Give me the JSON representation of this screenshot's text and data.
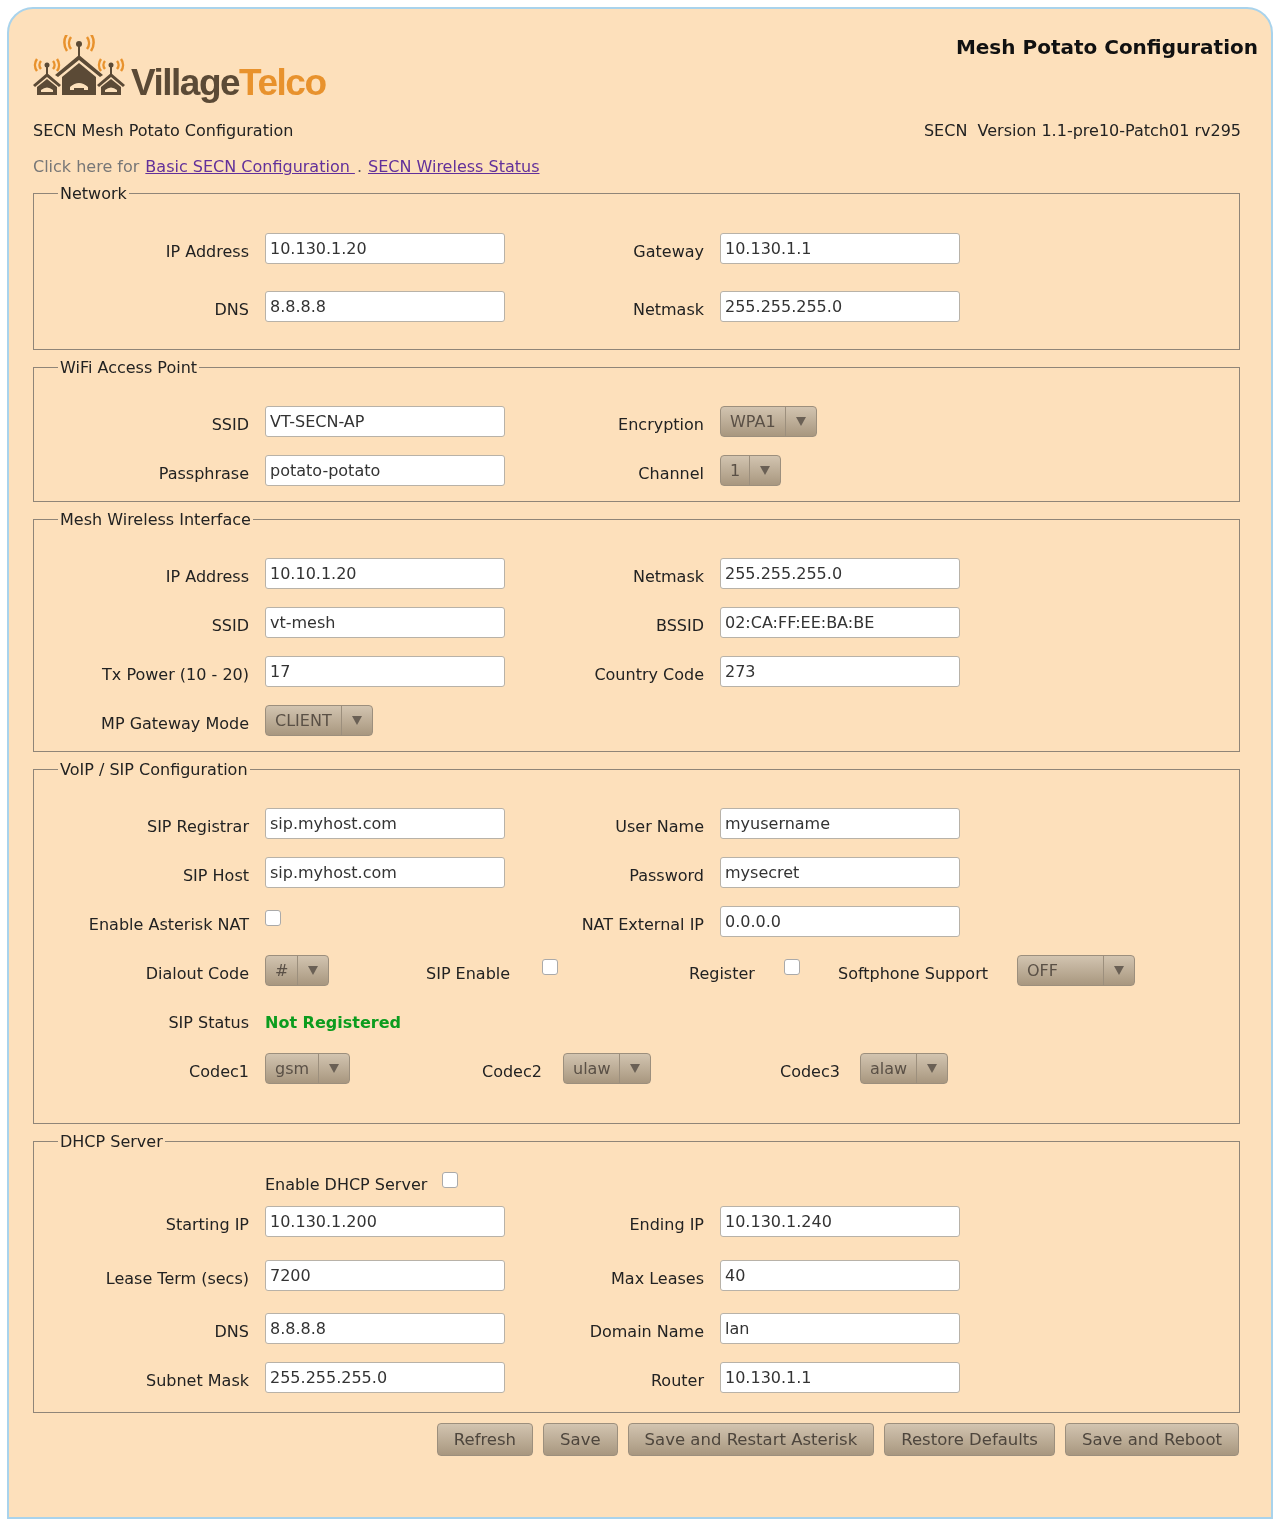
{
  "header": {
    "logo": {
      "wordmark": [
        "Village",
        "Telco"
      ]
    },
    "title": "Mesh Potato Configuration",
    "subtitle": "SECN Mesh Potato Configuration",
    "version": "SECN  Version 1.1-pre10-Patch01 rv295",
    "links_intro": "Click here for",
    "links": [
      "Basic SECN Configuration ",
      "SECN Wireless Status"
    ],
    "link_separator": "."
  },
  "sections": [
    {
      "legend": "Network",
      "rows": [
        {
          "kind": "fields",
          "items": [
            {
              "kind": "text",
              "label": "IP Address",
              "value": "10.130.1.20"
            },
            {
              "kind": "text",
              "label": "Gateway",
              "value": "10.130.1.1"
            }
          ]
        },
        {
          "kind": "fields",
          "items": [
            {
              "kind": "text",
              "label": "DNS",
              "value": "8.8.8.8"
            },
            {
              "kind": "text",
              "label": "Netmask",
              "value": "255.255.255.0"
            }
          ]
        }
      ]
    },
    {
      "legend": "WiFi Access Point",
      "rows": [
        {
          "kind": "fields",
          "items": [
            {
              "kind": "text",
              "label": "SSID",
              "value": "VT-SECN-AP"
            },
            {
              "kind": "select",
              "label": "Encryption",
              "value": "WPA1"
            }
          ]
        },
        {
          "kind": "fields",
          "items": [
            {
              "kind": "text",
              "label": "Passphrase",
              "value": "potato-potato"
            },
            {
              "kind": "select",
              "label": "Channel",
              "value": "1"
            }
          ]
        }
      ]
    },
    {
      "legend": "Mesh Wireless Interface",
      "rows": [
        {
          "kind": "fields",
          "items": [
            {
              "kind": "text",
              "label": "IP Address",
              "value": "10.10.1.20"
            },
            {
              "kind": "text",
              "label": "Netmask",
              "value": "255.255.255.0"
            }
          ]
        },
        {
          "kind": "fields",
          "items": [
            {
              "kind": "text",
              "label": "SSID",
              "value": "vt-mesh"
            },
            {
              "kind": "text",
              "label": "BSSID",
              "value": "02:CA:FF:EE:BA:BE"
            }
          ]
        },
        {
          "kind": "fields",
          "items": [
            {
              "kind": "text",
              "label": "Tx Power (10 - 20)",
              "value": "17"
            },
            {
              "kind": "text",
              "label": "Country Code",
              "value": "273"
            }
          ]
        },
        {
          "kind": "fields",
          "items": [
            {
              "kind": "select",
              "label": "MP Gateway Mode",
              "value": "CLIENT"
            }
          ]
        }
      ]
    },
    {
      "legend": "VoIP / SIP Configuration",
      "rows": [
        {
          "kind": "fields",
          "items": [
            {
              "kind": "text",
              "label": "SIP Registrar",
              "value": "sip.myhost.com"
            },
            {
              "kind": "text",
              "label": "User Name",
              "value": "myusername"
            }
          ]
        },
        {
          "kind": "fields",
          "items": [
            {
              "kind": "text",
              "label": "SIP Host",
              "value": "sip.myhost.com"
            },
            {
              "kind": "text",
              "label": "Password",
              "value": "mysecret"
            }
          ]
        },
        {
          "kind": "fields",
          "items": [
            {
              "kind": "checkbox",
              "label": "Enable Asterisk NAT",
              "checked": false
            },
            {
              "kind": "text",
              "label": "NAT External IP",
              "value": "0.0.0.0"
            }
          ]
        },
        {
          "kind": "mixed",
          "items": [
            {
              "kind": "select",
              "label": "Dialout Code",
              "value": "#"
            },
            {
              "kind": "checkbox",
              "label": "SIP Enable",
              "checked": false
            },
            {
              "kind": "checkbox",
              "label": "Register",
              "checked": false
            },
            {
              "kind": "select",
              "label": "Softphone Support",
              "value": "OFF"
            }
          ]
        },
        {
          "kind": "fields",
          "items": [
            {
              "kind": "status",
              "label": "SIP Status",
              "value": "Not Registered"
            }
          ]
        },
        {
          "kind": "codecs",
          "items": [
            {
              "kind": "select",
              "label": "Codec1",
              "value": "gsm"
            },
            {
              "kind": "select",
              "label": "Codec2",
              "value": "ulaw"
            },
            {
              "kind": "select",
              "label": "Codec3",
              "value": "alaw"
            }
          ]
        }
      ]
    },
    {
      "legend": "DHCP Server",
      "rows": [
        {
          "kind": "indented",
          "items": [
            {
              "kind": "checkbox",
              "label": "Enable DHCP Server",
              "checked": false
            }
          ]
        },
        {
          "kind": "fields",
          "items": [
            {
              "kind": "text",
              "label": "Starting IP",
              "value": "10.130.1.200"
            },
            {
              "kind": "text",
              "label": "Ending IP",
              "value": "10.130.1.240"
            }
          ]
        },
        {
          "kind": "fields",
          "items": [
            {
              "kind": "text",
              "label": "Lease Term (secs)",
              "value": "7200"
            },
            {
              "kind": "text",
              "label": "Max Leases",
              "value": "40"
            }
          ]
        },
        {
          "kind": "fields",
          "items": [
            {
              "kind": "text",
              "label": "DNS",
              "value": "8.8.8.8"
            },
            {
              "kind": "text",
              "label": "Domain Name",
              "value": "lan"
            }
          ]
        },
        {
          "kind": "fields",
          "items": [
            {
              "kind": "text",
              "label": "Subnet Mask",
              "value": "255.255.255.0"
            },
            {
              "kind": "text",
              "label": "Router",
              "value": "10.130.1.1"
            }
          ]
        }
      ]
    }
  ],
  "buttons": [
    "Refresh",
    "Save",
    "Save and Restart Asterisk",
    "Restore Defaults",
    "Save and Reboot"
  ]
}
